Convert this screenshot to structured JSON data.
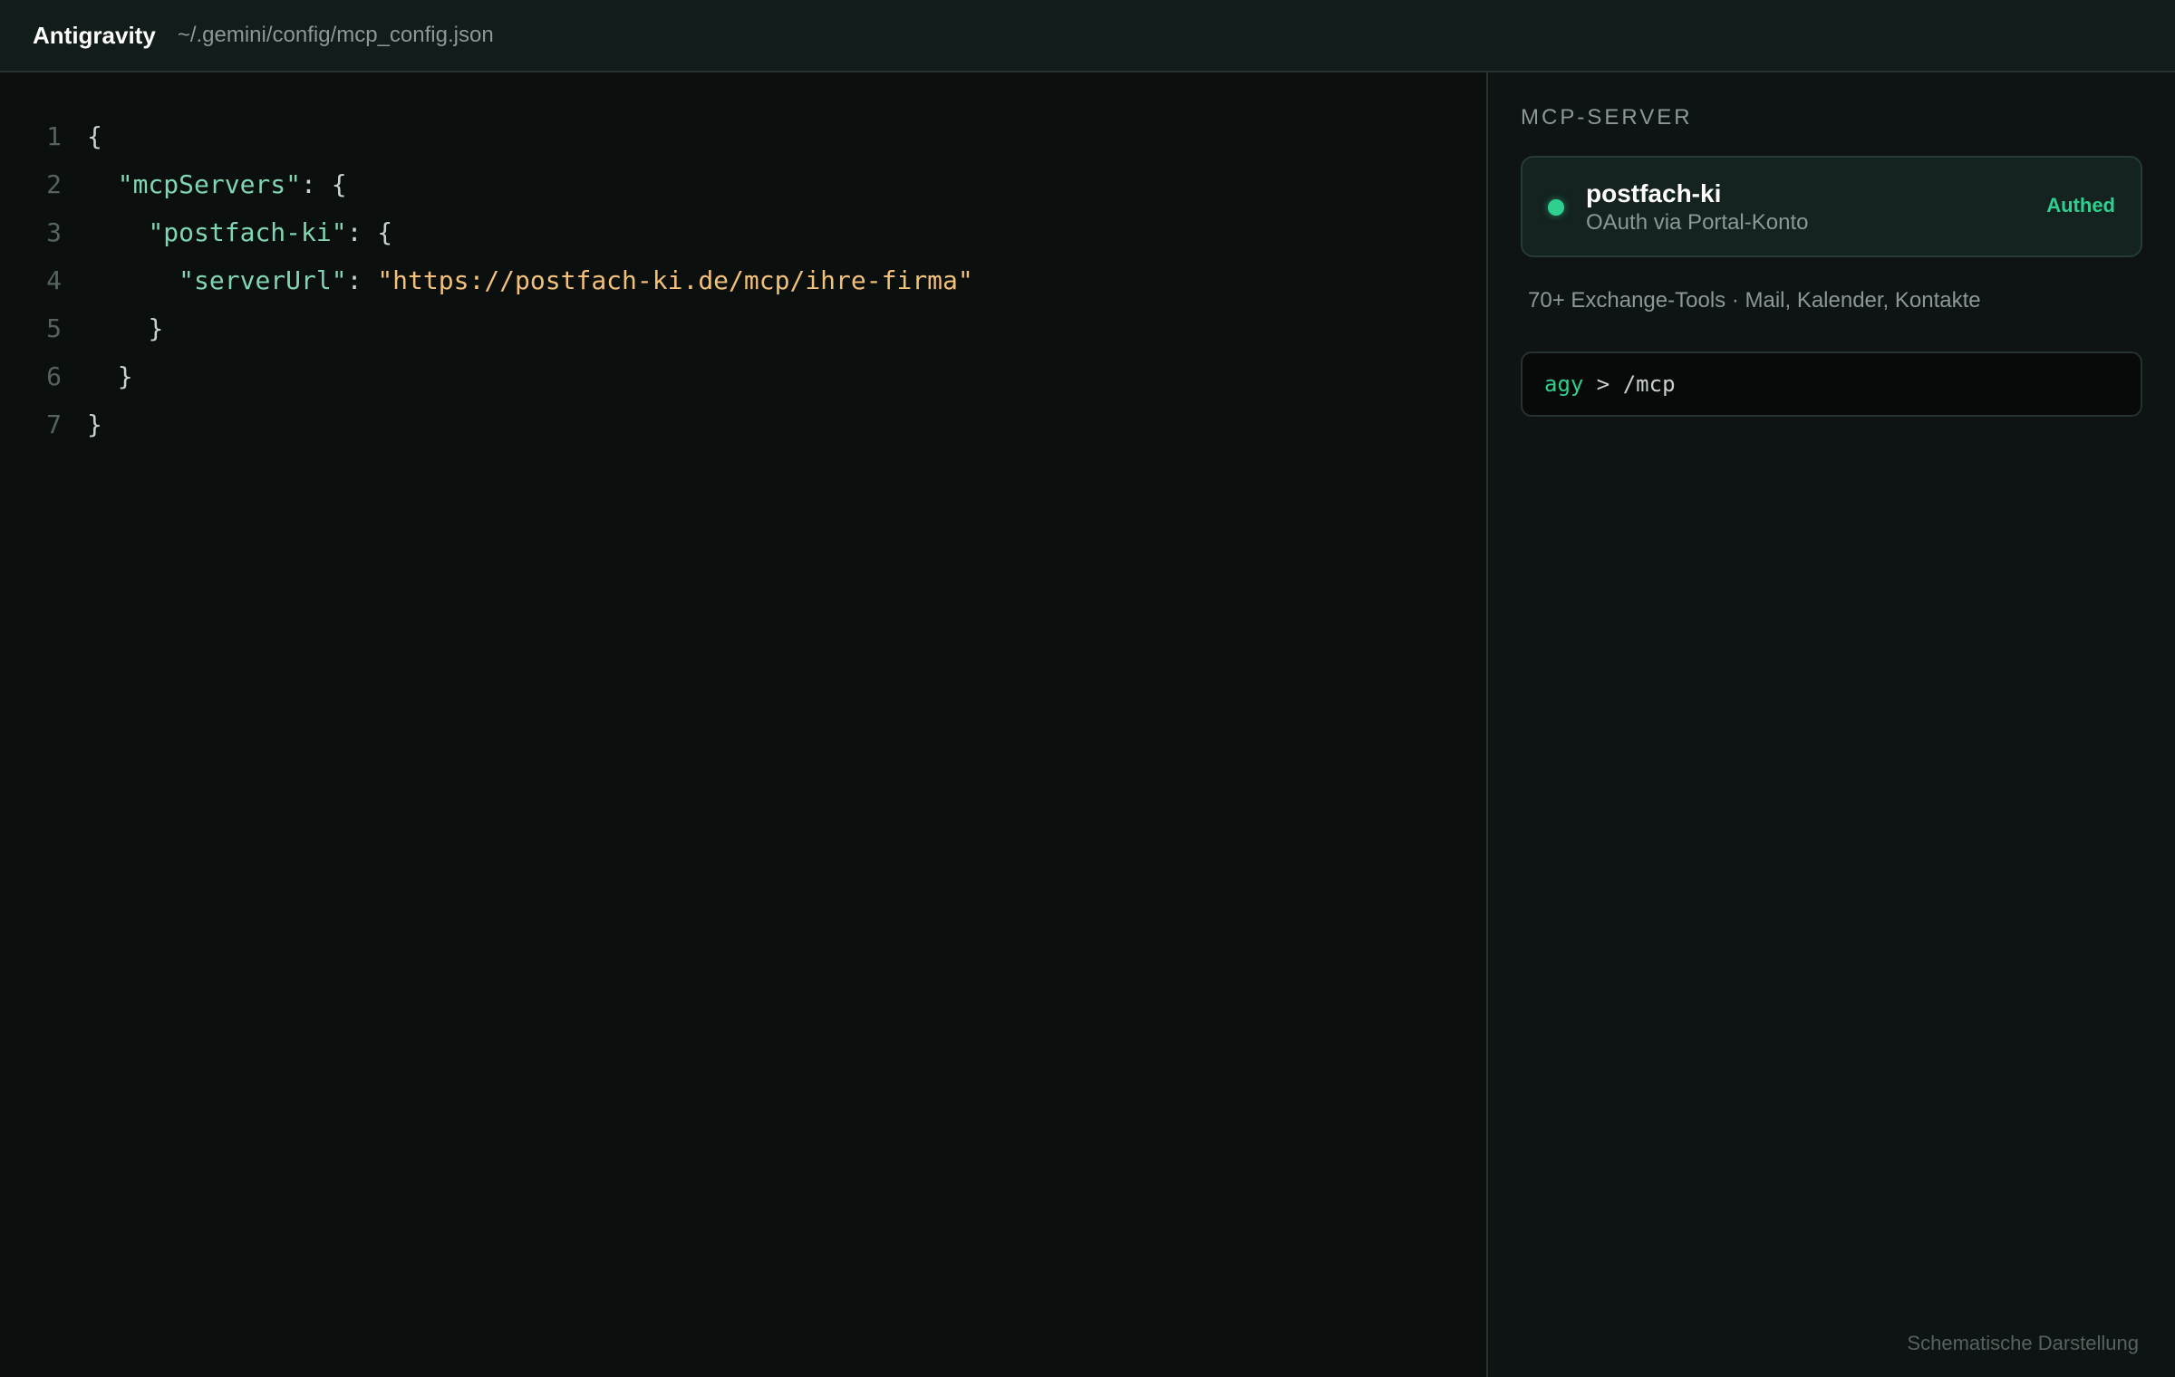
{
  "header": {
    "app_title": "Antigravity",
    "file_path": "~/.gemini/config/mcp_config.json"
  },
  "editor": {
    "lines": [
      {
        "num": "1",
        "indent": "",
        "key": "",
        "mid": "{",
        "str": "",
        "tail": ""
      },
      {
        "num": "2",
        "indent": "  ",
        "key": "\"mcpServers\"",
        "mid": ": {",
        "str": "",
        "tail": ""
      },
      {
        "num": "3",
        "indent": "    ",
        "key": "\"postfach-ki\"",
        "mid": ": {",
        "str": "",
        "tail": ""
      },
      {
        "num": "4",
        "indent": "      ",
        "key": "\"serverUrl\"",
        "mid": ": ",
        "str": "\"https://postfach-ki.de/mcp/ihre-firma\"",
        "tail": ""
      },
      {
        "num": "5",
        "indent": "    ",
        "key": "",
        "mid": "}",
        "str": "",
        "tail": ""
      },
      {
        "num": "6",
        "indent": "  ",
        "key": "",
        "mid": "}",
        "str": "",
        "tail": ""
      },
      {
        "num": "7",
        "indent": "",
        "key": "",
        "mid": "}",
        "str": "",
        "tail": ""
      }
    ]
  },
  "panel": {
    "heading": "MCP-SERVER",
    "server": {
      "name": "postfach-ki",
      "auth": "OAuth via Portal-Konto",
      "status": "Authed",
      "status_color": "#2fd08f"
    },
    "tools_description": "70+ Exchange-Tools · Mail, Kalender, Kontakte",
    "terminal": {
      "prompt": "agy",
      "separator": " > ",
      "command": "/mcp"
    }
  },
  "footnote": "Schematische Darstellung",
  "colors": {
    "background": "#0b0f0e",
    "accent": "#2fd08f",
    "json_key": "#7fd6b1",
    "json_string": "#f2c078"
  }
}
